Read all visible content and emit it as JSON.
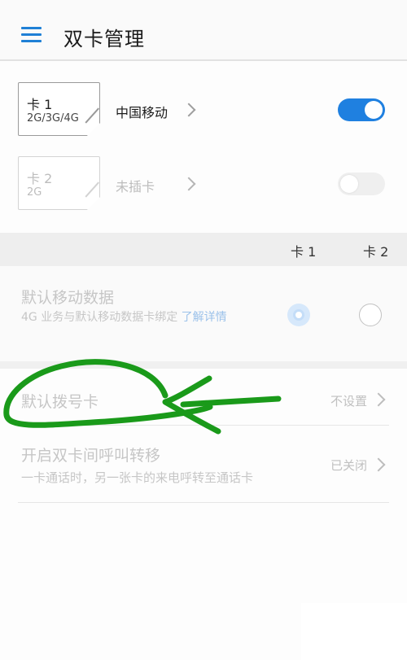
{
  "header": {
    "title": "双卡管理"
  },
  "sim1": {
    "name": "卡 1",
    "network": "2G/3G/4G",
    "carrier": "中国移动",
    "enabled": true
  },
  "sim2": {
    "name": "卡 2",
    "network": "2G",
    "carrier": "未插卡",
    "enabled": false
  },
  "columns": {
    "sim1": "卡 1",
    "sim2": "卡 2"
  },
  "default_data": {
    "title": "默认移动数据",
    "description": "4G 业务与默认移动数据卡绑定",
    "link": "了解详情",
    "selected": "sim1"
  },
  "default_dial": {
    "title": "默认拨号卡",
    "value": "不设置"
  },
  "call_forwarding": {
    "title": "开启双卡间呼叫转移",
    "description": "一卡通话时，另一张卡的来电呼转至通话卡",
    "value": "已关闭"
  },
  "colors": {
    "accent": "#1f80e0",
    "annotation": "#1a9a1a"
  }
}
